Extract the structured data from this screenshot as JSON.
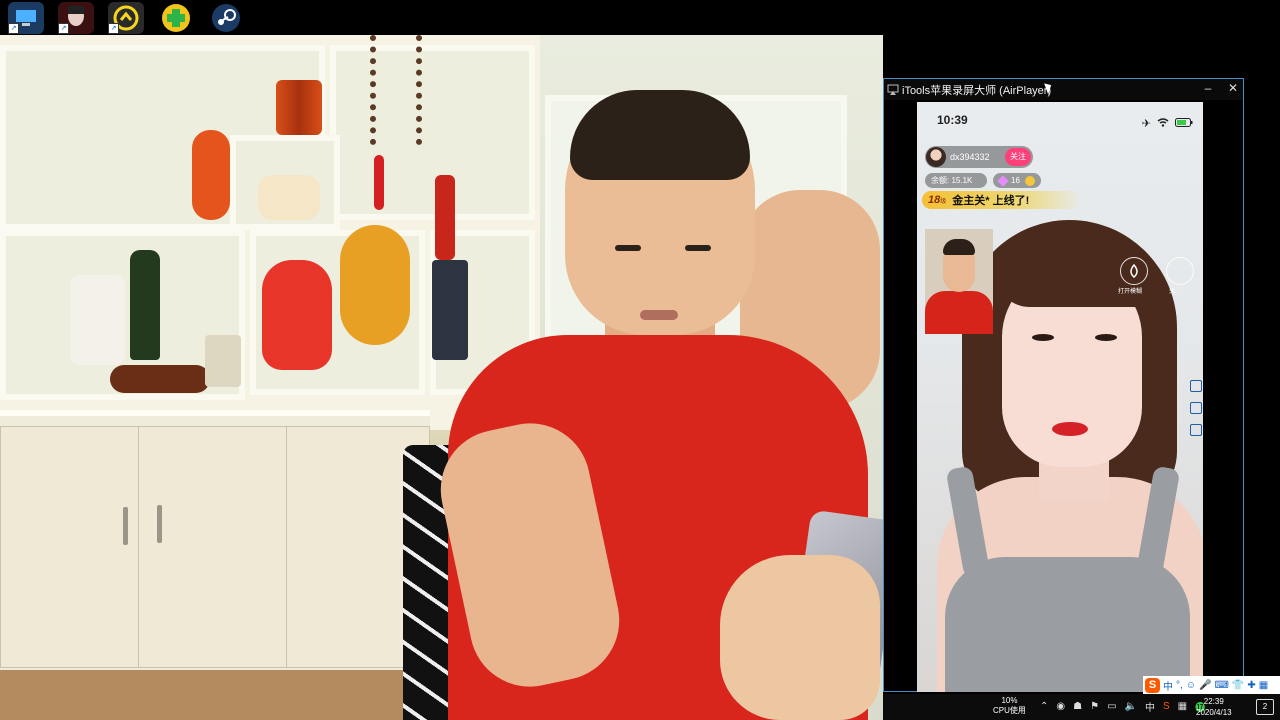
{
  "desktop": {
    "icons": [
      {
        "name": "computer-icon"
      },
      {
        "name": "game-character-icon"
      },
      {
        "name": "sogou-yellow-icon"
      },
      {
        "name": "green-plus-icon"
      },
      {
        "name": "steam-icon"
      }
    ]
  },
  "airplayer": {
    "title": "iTools苹果录屏大师 (AirPlayer)",
    "minimize": "–",
    "close": "✕",
    "phone": {
      "time": "10:39",
      "host_name": "dx394332",
      "follow_label": "关注",
      "balance": "余额: 15.1K",
      "gem_count": "16",
      "level_number": "18",
      "level_suffix": "级",
      "banner_text": "金主关* 上线了!",
      "side_button_1": "打开模糊",
      "side_button_2": "关..."
    }
  },
  "taskbar": {
    "cpu_percent": "10%",
    "cpu_label": "CPU使用",
    "ime_mode": "中",
    "time": "22:39",
    "date": "2020/4/13",
    "notification_count": "2"
  },
  "ime": {
    "logo": "S",
    "items": [
      "中",
      "°,",
      "☺",
      "🎤",
      "⌨",
      "👕",
      "✚",
      "▦"
    ]
  },
  "colors": {
    "follow": "#ff3f7a",
    "banner": "#f5be28",
    "shirt": "#d8261c",
    "window_border": "#4a90c8"
  }
}
